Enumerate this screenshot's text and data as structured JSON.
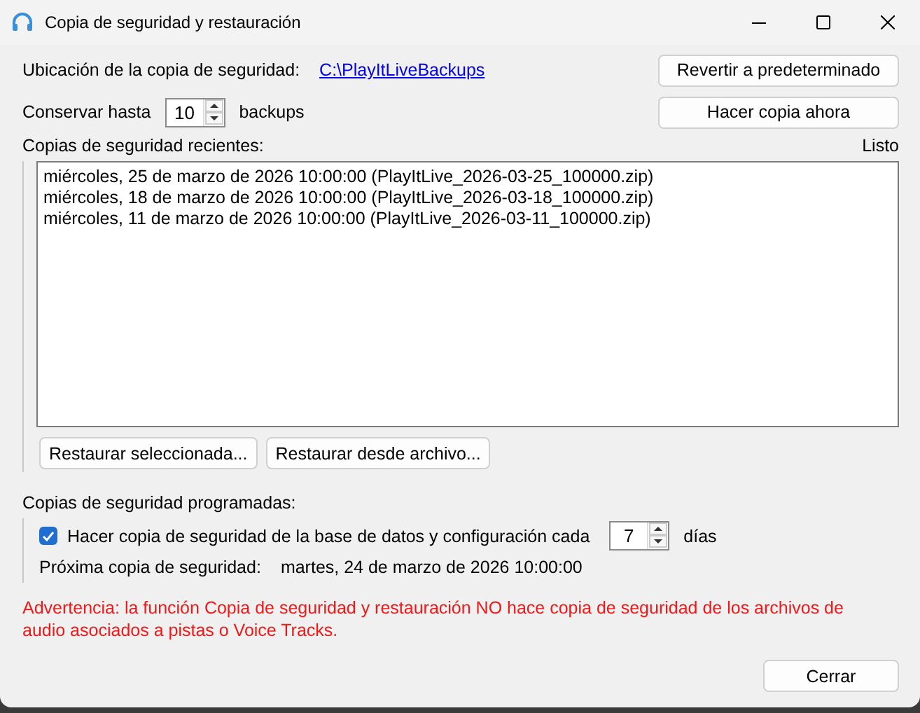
{
  "window": {
    "title": "Copia de seguridad y restauración"
  },
  "location": {
    "label": "Ubicación de la copia de seguridad:",
    "path": "C:\\PlayItLiveBackups"
  },
  "keep": {
    "label": "Conservar hasta",
    "value": "10",
    "unit": "backups"
  },
  "top_buttons": [
    "Revertir a predeterminado",
    "Hacer copia ahora"
  ],
  "recent": {
    "label": "Copias de seguridad recientes:",
    "status": "Listo",
    "items": [
      "miércoles, 25 de marzo de 2026 10:00:00 (PlayItLive_2026-03-25_100000.zip)",
      "miércoles, 18 de marzo de 2026 10:00:00 (PlayItLive_2026-03-18_100000.zip)",
      "miércoles, 11 de marzo de 2026 10:00:00 (PlayItLive_2026-03-11_100000.zip)"
    ],
    "buttons": [
      "Restaurar seleccionada...",
      "Restaurar desde archivo..."
    ]
  },
  "scheduled": {
    "label": "Copias de seguridad programadas:",
    "checkbox": {
      "label": "Hacer copia de seguridad de la base de datos y configuración cada",
      "checked": true
    },
    "interval": "7",
    "unit": "días",
    "next_label": "Próxima copia de seguridad:",
    "next_value": "martes, 24 de marzo de 2026 10:00:00"
  },
  "warning": "Advertencia: la función Copia de seguridad y restauración NO hace copia de seguridad de los archivos de audio asociados a pistas o Voice Tracks.",
  "close_button": "Cerrar"
}
